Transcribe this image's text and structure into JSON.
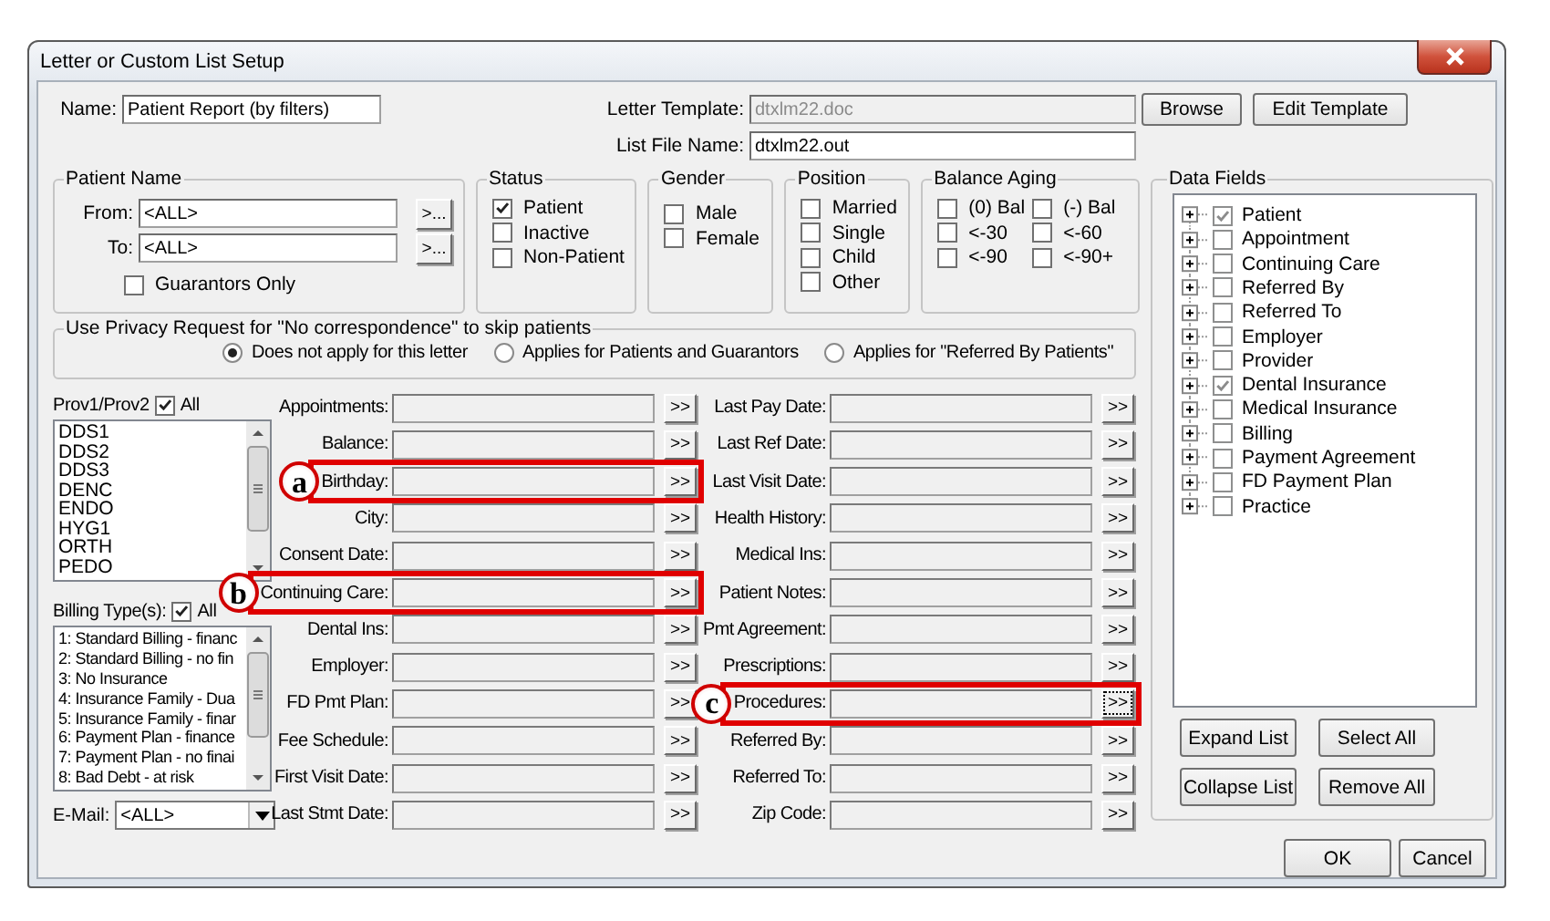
{
  "window": {
    "title": "Letter or Custom List Setup"
  },
  "name": {
    "label": "Name:",
    "value": "Patient Report (by filters)"
  },
  "letter_template": {
    "label": "Letter Template:",
    "value": "dtxlm22.doc",
    "disabled": true
  },
  "list_file_name": {
    "label": "List File Name:",
    "value": "dtxlm22.out"
  },
  "top_buttons": [
    "Browse",
    "Edit Template"
  ],
  "patient_name": {
    "title": "Patient Name",
    "from": {
      "label": "From:",
      "value": "<ALL>",
      "button": ">..."
    },
    "to": {
      "label": "To:",
      "value": "<ALL>",
      "button": ">..."
    },
    "guarantors_only": {
      "label": "Guarantors Only",
      "checked": false
    }
  },
  "status": {
    "title": "Status",
    "options": [
      {
        "label": "Patient",
        "checked": true
      },
      {
        "label": "Inactive",
        "checked": false
      },
      {
        "label": "Non-Patient",
        "checked": false
      }
    ]
  },
  "gender": {
    "title": "Gender",
    "options": [
      {
        "label": "Male",
        "checked": false
      },
      {
        "label": "Female",
        "checked": false
      }
    ]
  },
  "position": {
    "title": "Position",
    "options": [
      {
        "label": "Married",
        "checked": false
      },
      {
        "label": "Single",
        "checked": false
      },
      {
        "label": "Child",
        "checked": false
      },
      {
        "label": "Other",
        "checked": false
      }
    ]
  },
  "balance_aging": {
    "title": "Balance Aging",
    "options": [
      {
        "label": "(0) Bal",
        "checked": false
      },
      {
        "label": "(-) Bal",
        "checked": false
      },
      {
        "label": "<-30",
        "checked": false
      },
      {
        "label": "<-60",
        "checked": false
      },
      {
        "label": "<-90",
        "checked": false
      },
      {
        "label": "<-90+",
        "checked": false
      }
    ]
  },
  "privacy": {
    "title": "Use Privacy Request for \"No correspondence\" to skip patients",
    "options": [
      {
        "label": "Does not apply for this letter",
        "selected": true
      },
      {
        "label": "Applies for Patients and Guarantors",
        "selected": false
      },
      {
        "label": "Applies for \"Referred By Patients\"",
        "selected": false
      }
    ]
  },
  "providers": {
    "label": "Prov1/Prov2",
    "all": {
      "label": "All",
      "checked": true
    },
    "items": [
      "DDS1",
      "DDS2",
      "DDS3",
      "DENC",
      "ENDO",
      "HYG1",
      "ORTH",
      "PEDO"
    ]
  },
  "billing_types": {
    "label": "Billing Type(s):",
    "all": {
      "label": "All",
      "checked": true
    },
    "items": [
      "1: Standard Billing - financ",
      "2: Standard Billing - no fin",
      "3: No Insurance",
      "4: Insurance Family - Dua",
      "5: Insurance Family - finar",
      "6: Payment Plan - finance",
      "7: Payment Plan - no finai",
      "8: Bad Debt - at risk"
    ]
  },
  "email": {
    "label": "E-Mail:",
    "value": "<ALL>"
  },
  "filters": {
    "columns": [
      [
        {
          "label": "Appointments:",
          "button": ">>",
          "focused": false
        },
        {
          "label": "Balance:",
          "button": ">>",
          "focused": false
        },
        {
          "label": "Birthday:",
          "button": ">>",
          "focused": false,
          "callout": "a"
        },
        {
          "label": "City:",
          "button": ">>",
          "focused": false
        },
        {
          "label": "Consent Date:",
          "button": ">>",
          "focused": false
        },
        {
          "label": "Continuing Care:",
          "button": ">>",
          "focused": false,
          "callout": "b"
        },
        {
          "label": "Dental Ins:",
          "button": ">>",
          "focused": false
        },
        {
          "label": "Employer:",
          "button": ">>",
          "focused": false
        },
        {
          "label": "FD Pmt Plan:",
          "button": ">>",
          "focused": false
        },
        {
          "label": "Fee Schedule:",
          "button": ">>",
          "focused": false
        },
        {
          "label": "First Visit Date:",
          "button": ">>",
          "focused": false
        },
        {
          "label": "Last Stmt Date:",
          "button": ">>",
          "focused": false
        }
      ],
      [
        {
          "label": "Last Pay Date:",
          "button": ">>",
          "focused": false
        },
        {
          "label": "Last Ref Date:",
          "button": ">>",
          "focused": false
        },
        {
          "label": "Last Visit Date:",
          "button": ">>",
          "focused": false
        },
        {
          "label": "Health History:",
          "button": ">>",
          "focused": false
        },
        {
          "label": "Medical Ins:",
          "button": ">>",
          "focused": false
        },
        {
          "label": "Patient Notes:",
          "button": ">>",
          "focused": false
        },
        {
          "label": "Pmt Agreement:",
          "button": ">>",
          "focused": false
        },
        {
          "label": "Prescriptions:",
          "button": ">>",
          "focused": false
        },
        {
          "label": "Procedures:",
          "button": ">>",
          "focused": true,
          "callout": "c"
        },
        {
          "label": "Referred By:",
          "button": ">>",
          "focused": false
        },
        {
          "label": "Referred To:",
          "button": ">>",
          "focused": false
        },
        {
          "label": "Zip Code:",
          "button": ">>",
          "focused": false
        }
      ]
    ]
  },
  "data_fields": {
    "title": "Data Fields",
    "items": [
      {
        "label": "Patient",
        "checked": true
      },
      {
        "label": "Appointment",
        "checked": false
      },
      {
        "label": "Continuing Care",
        "checked": false
      },
      {
        "label": "Referred By",
        "checked": false
      },
      {
        "label": "Referred To",
        "checked": false
      },
      {
        "label": "Employer",
        "checked": false
      },
      {
        "label": "Provider",
        "checked": false
      },
      {
        "label": "Dental Insurance",
        "checked": true
      },
      {
        "label": "Medical Insurance",
        "checked": false
      },
      {
        "label": "Billing",
        "checked": false
      },
      {
        "label": "Payment Agreement",
        "checked": false
      },
      {
        "label": "FD Payment Plan",
        "checked": false
      },
      {
        "label": "Practice",
        "checked": false
      }
    ],
    "buttons": [
      "Expand List",
      "Select All",
      "Collapse List",
      "Remove All"
    ]
  },
  "dialog_buttons": [
    "OK",
    "Cancel"
  ]
}
